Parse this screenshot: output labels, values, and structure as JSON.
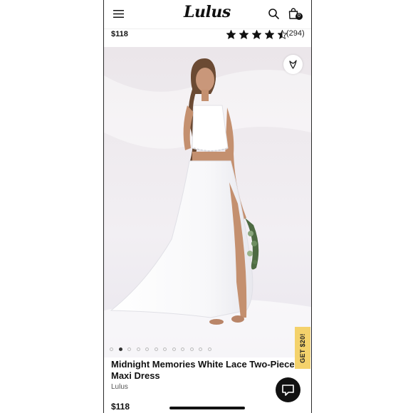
{
  "header": {
    "logo_text": "Lulus",
    "cart_count": "0",
    "icons": [
      "menu-icon",
      "search-icon",
      "shopping-bag-icon"
    ]
  },
  "summary_bar": {
    "price": "$118",
    "rating": 4.5,
    "rating_max": 5,
    "review_count": "(294)"
  },
  "gallery": {
    "image_count": 12,
    "active_index": 1,
    "heart_icon": "heart-icon"
  },
  "promo": {
    "label": "GET $20!"
  },
  "product": {
    "title": "Midnight Memories White Lace Two-Piece Maxi Dress",
    "brand": "Lulus",
    "price": "$118"
  },
  "chat": {
    "icon": "chat-icon"
  },
  "colors": {
    "promo_bg": "#f4d26c",
    "chat_bg": "#111111"
  }
}
